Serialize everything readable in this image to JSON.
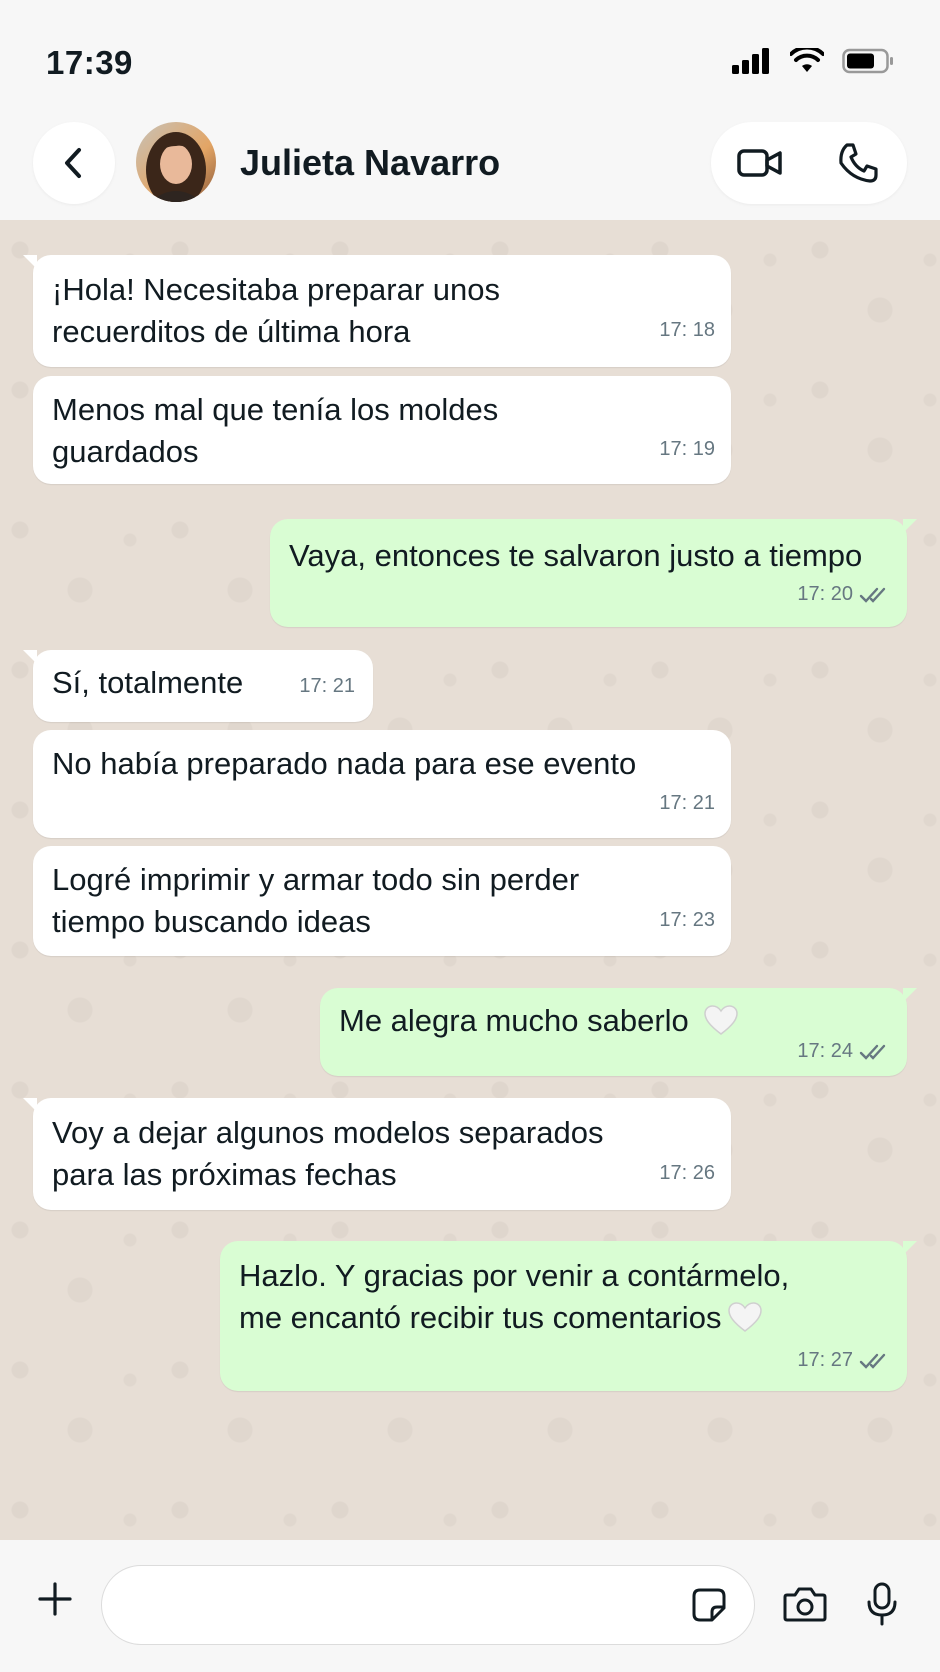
{
  "status_bar": {
    "time": "17:39"
  },
  "header": {
    "contact_name": "Julieta Navarro"
  },
  "messages": [
    {
      "direction": "incoming",
      "lines": [
        "¡Hola! Necesitaba preparar unos",
        "recuerditos de última hora"
      ],
      "time": "17: 18"
    },
    {
      "direction": "incoming",
      "lines": [
        "Menos mal que tenía los moldes",
        "guardados"
      ],
      "time": "17: 19"
    },
    {
      "direction": "outgoing",
      "lines": [
        "Vaya, entonces te salvaron justo a tiempo"
      ],
      "time": "17: 20",
      "read": true
    },
    {
      "direction": "incoming",
      "lines": [
        "Sí, totalmente"
      ],
      "time": "17: 21"
    },
    {
      "direction": "incoming",
      "lines": [
        "No había preparado nada para ese evento"
      ],
      "time": "17: 21"
    },
    {
      "direction": "incoming",
      "lines": [
        "Logré imprimir y armar todo sin perder",
        "tiempo buscando ideas"
      ],
      "time": "17: 23"
    },
    {
      "direction": "outgoing",
      "lines": [
        "Me alegra mucho saberlo"
      ],
      "time": "17: 24",
      "read": true,
      "emoji": "white-heart"
    },
    {
      "direction": "incoming",
      "lines": [
        "Voy a dejar algunos modelos separados",
        "para las próximas fechas"
      ],
      "time": "17: 26"
    },
    {
      "direction": "outgoing",
      "lines": [
        "Hazlo. Y gracias por venir a contármelo,",
        "me encantó recibir tus comentarios"
      ],
      "time": "17: 27",
      "read": true,
      "emoji": "white-heart"
    }
  ],
  "composer": {
    "value": "",
    "placeholder": ""
  },
  "icons": {
    "back": "chevron-left-icon",
    "video": "video-camera-icon",
    "call": "phone-icon",
    "plus": "plus-icon",
    "sticker": "sticker-icon",
    "camera": "camera-icon",
    "mic": "microphone-icon"
  },
  "colors": {
    "incoming_bubble": "#ffffff",
    "outgoing_bubble": "#d9fdd3",
    "chat_background": "#e7ded5",
    "read_ticks": "#667781"
  }
}
